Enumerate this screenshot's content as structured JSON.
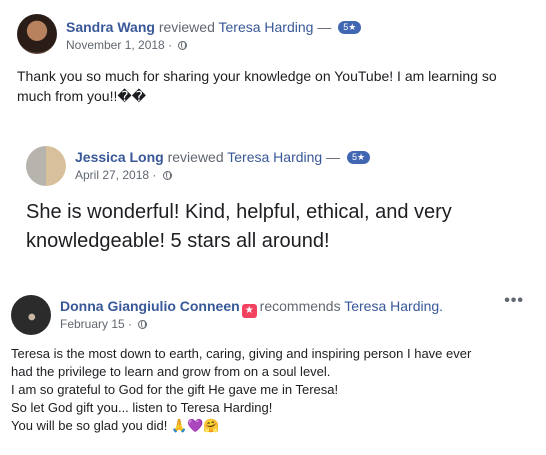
{
  "reviews": [
    {
      "author": "Sandra Wang",
      "action": "reviewed",
      "target": "Teresa Harding",
      "separator": "—",
      "rating_badge": "5★",
      "date": "November 1, 2018",
      "dot": "·",
      "lines": [
        "Thank you so much for sharing your knowledge on YouTube! I am learning so",
        "much from you!!��"
      ]
    },
    {
      "author": "Jessica Long",
      "action": "reviewed",
      "target": "Teresa Harding",
      "separator": "—",
      "rating_badge": "5★",
      "date": "April 27, 2018",
      "dot": "·",
      "lines": [
        "She is wonderful! Kind, helpful, ethical, and very",
        "knowledgeable! 5 stars all around!"
      ]
    },
    {
      "author": "Donna Giangiulio Conneen",
      "action": "recommends",
      "target": "Teresa Harding.",
      "recommend_icon": "★",
      "date": "February 15",
      "dot": "·",
      "more": "•••",
      "lines": [
        "Teresa is the most down to earth, caring, giving and inspiring person I have ever",
        "had the privilege to learn and grow from on a soul level.",
        "I am so grateful to God for the gift He gave me in Teresa!",
        "So let God gift you... listen to Teresa Harding!",
        "You will be so glad you did! 🙏💜🤗"
      ]
    }
  ]
}
